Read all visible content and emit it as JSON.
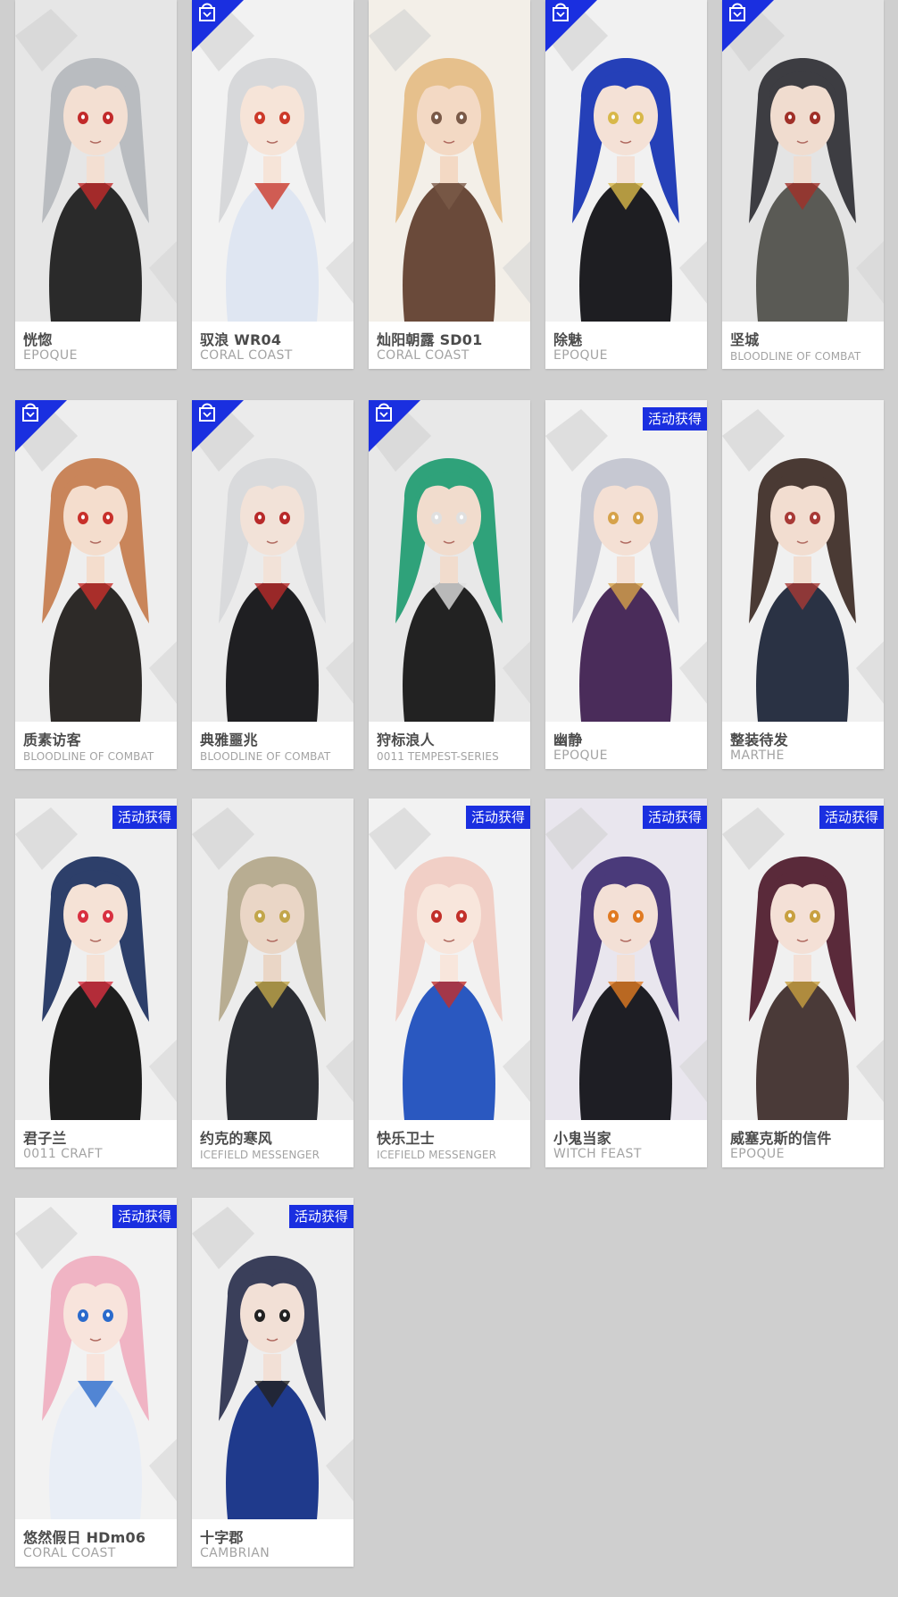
{
  "badge_colors": {
    "store": "#1a2fe0",
    "event": "#1a2fe0"
  },
  "icons": {
    "store_badge": "store-bag-icon"
  },
  "cards": [
    {
      "name": "恍惚",
      "brand": "EPOQUE",
      "badge": "none",
      "palette": {
        "bg": "#e6e6e6",
        "hair": "#b9bcc0",
        "outfit": "#2a2a2a",
        "skin": "#f3dfd2",
        "accent": "#c22a2a"
      }
    },
    {
      "name": "驭浪 WR04",
      "brand": "CORAL COAST",
      "badge": "store",
      "palette": {
        "bg": "#f2f2f2",
        "hair": "#d7d8da",
        "outfit": "#dfe6f2",
        "skin": "#f6e4d8",
        "accent": "#cc3a2a"
      }
    },
    {
      "name": "灿阳朝露 SD01",
      "brand": "CORAL COAST",
      "badge": "none",
      "palette": {
        "bg": "#f3efe8",
        "hair": "#e6c08c",
        "outfit": "#6a4a3a",
        "skin": "#f3d9c4",
        "accent": "#7a5a48"
      }
    },
    {
      "name": "除魅",
      "brand": "EPOQUE",
      "badge": "store",
      "palette": {
        "bg": "#f1f1f1",
        "hair": "#2540b8",
        "outfit": "#1e1e22",
        "skin": "#f4e1d6",
        "accent": "#d8b84a"
      }
    },
    {
      "name": "坚城",
      "brand": "BLOODLINE OF COMBAT",
      "badge": "store",
      "palette": {
        "bg": "#e4e4e4",
        "hair": "#3d3d42",
        "outfit": "#5a5a55",
        "skin": "#f0dccf",
        "accent": "#a03028"
      }
    },
    {
      "name": "质素访客",
      "brand": "BLOODLINE OF COMBAT",
      "badge": "store",
      "palette": {
        "bg": "#eeeeee",
        "hair": "#c9855a",
        "outfit": "#2d2a28",
        "skin": "#f4ddcd",
        "accent": "#c8302a"
      }
    },
    {
      "name": "典雅噩兆",
      "brand": "BLOODLINE OF COMBAT",
      "badge": "store",
      "palette": {
        "bg": "#ebebeb",
        "hair": "#d9dadc",
        "outfit": "#1f1f22",
        "skin": "#f2e2d8",
        "accent": "#b82a2a"
      }
    },
    {
      "name": "狩标浪人",
      "brand": "0011 TEMPEST-SERIES",
      "badge": "store",
      "palette": {
        "bg": "#e8e8e8",
        "hair": "#2fa27a",
        "outfit": "#222222",
        "skin": "#f1dccd",
        "accent": "#e0e0e0"
      }
    },
    {
      "name": "幽静",
      "brand": "EPOQUE",
      "badge": "event",
      "badge_text": "活动获得",
      "palette": {
        "bg": "#f2f2f2",
        "hair": "#c6c8d2",
        "outfit": "#4a2c5a",
        "skin": "#f4e0d4",
        "accent": "#d6a24a"
      }
    },
    {
      "name": "整装待发",
      "brand": "MARTHE",
      "badge": "none",
      "palette": {
        "bg": "#f0f0f0",
        "hair": "#4a3a34",
        "outfit": "#2a3244",
        "skin": "#f2ddd0",
        "accent": "#a83a36"
      }
    },
    {
      "name": "君子兰",
      "brand": "0011 CRAFT",
      "badge": "event",
      "badge_text": "活动获得",
      "palette": {
        "bg": "#efefef",
        "hair": "#2d3f6a",
        "outfit": "#1e1e1e",
        "skin": "#f5e2d6",
        "accent": "#d83040"
      }
    },
    {
      "name": "约克的寒风",
      "brand": "ICEFIELD MESSENGER",
      "badge": "none",
      "palette": {
        "bg": "#ececec",
        "hair": "#b8ad92",
        "outfit": "#2b2d33",
        "skin": "#ead6c6",
        "accent": "#c2a64a"
      }
    },
    {
      "name": "快乐卫士",
      "brand": "ICEFIELD MESSENGER",
      "badge": "event",
      "badge_text": "活动获得",
      "palette": {
        "bg": "#f2f2f2",
        "hair": "#f1cfc6",
        "outfit": "#2a58c0",
        "skin": "#f8e6dc",
        "accent": "#c2302a"
      }
    },
    {
      "name": "小鬼当家",
      "brand": "WITCH FEAST",
      "badge": "event",
      "badge_text": "活动获得",
      "palette": {
        "bg": "#e9e6ee",
        "hair": "#4a3a7a",
        "outfit": "#1e1e24",
        "skin": "#f3e0d6",
        "accent": "#e07a22"
      }
    },
    {
      "name": "威塞克斯的信件",
      "brand": "EPOQUE",
      "badge": "event",
      "badge_text": "活动获得",
      "palette": {
        "bg": "#f0f0f0",
        "hair": "#5a2a3a",
        "outfit": "#4a3a38",
        "skin": "#f4e0d6",
        "accent": "#c8a040"
      }
    },
    {
      "name": "悠然假日 HDm06",
      "brand": "CORAL COAST",
      "badge": "event",
      "badge_text": "活动获得",
      "palette": {
        "bg": "#f2f2f2",
        "hair": "#f0b4c4",
        "outfit": "#e9eef6",
        "skin": "#f8e4dc",
        "accent": "#2a6acc"
      }
    },
    {
      "name": "十字郡",
      "brand": "CAMBRIAN",
      "badge": "event",
      "badge_text": "活动获得",
      "palette": {
        "bg": "#eeeeee",
        "hair": "#3a3f5a",
        "outfit": "#1f3a8c",
        "skin": "#f2e0d6",
        "accent": "#222222"
      }
    }
  ]
}
